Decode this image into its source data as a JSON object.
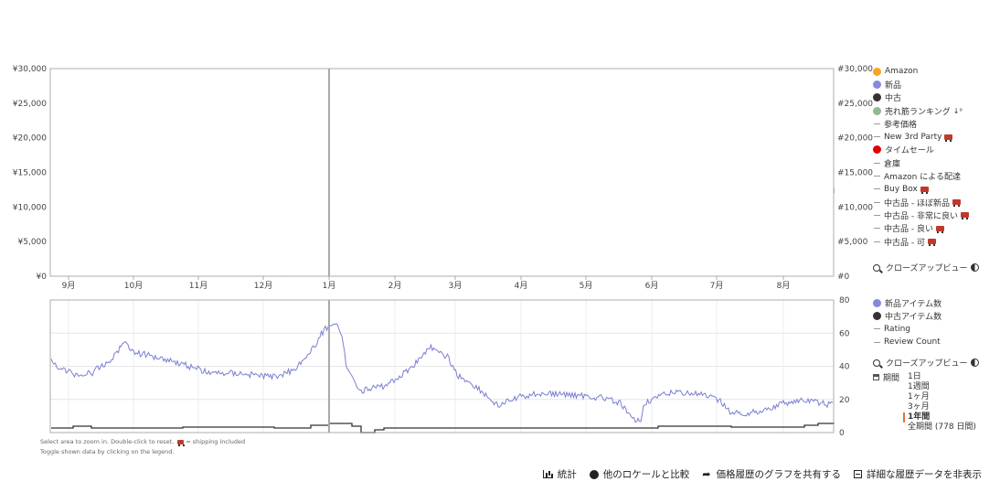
{
  "top_chart": {
    "y_left_ticks": [
      "¥30,000",
      "¥25,000",
      "¥20,000",
      "¥15,000",
      "¥10,000",
      "¥5,000",
      "¥0"
    ],
    "y_right_ticks": [
      "#30,000",
      "#25,000",
      "#20,000",
      "#15,000",
      "#10,000",
      "#5,000",
      "#0"
    ],
    "x_ticks": [
      "9月",
      "10月",
      "11月",
      "12月",
      "1月",
      "2月",
      "3月",
      "4月",
      "5月",
      "6月",
      "7月",
      "8月"
    ]
  },
  "bottom_chart": {
    "y_right_ticks": [
      "80",
      "60",
      "40",
      "20",
      "0"
    ]
  },
  "legend_top": [
    {
      "label": "Amazon",
      "marker": "dot",
      "color": "#f5a623"
    },
    {
      "label": "新品",
      "marker": "dot",
      "color": "#8888dd"
    },
    {
      "label": "中古",
      "marker": "dot",
      "color": "#333333"
    },
    {
      "label": "売れ筋ランキング",
      "marker": "dot",
      "color": "#8dbb8d",
      "extra": "sort-icon"
    },
    {
      "label": "参考価格",
      "marker": "dash",
      "color": "#999999"
    },
    {
      "label": "New 3rd Party",
      "marker": "dash",
      "color": "#999999",
      "truck": true
    },
    {
      "label": "タイムセール",
      "marker": "dot",
      "color": "#e00000"
    },
    {
      "label": "倉庫",
      "marker": "dash",
      "color": "#999999"
    },
    {
      "label": "Amazon による配達",
      "marker": "dash",
      "color": "#999999"
    },
    {
      "label": "Buy Box",
      "marker": "dash",
      "color": "#999999",
      "truck": true
    },
    {
      "label": "中古品 - ほぼ新品",
      "marker": "dash",
      "color": "#999999",
      "truck": true
    },
    {
      "label": "中古品 - 非常に良い",
      "marker": "dash",
      "color": "#999999",
      "truck": true
    },
    {
      "label": "中古品 - 良い",
      "marker": "dash",
      "color": "#999999",
      "truck": true
    },
    {
      "label": "中古品 - 可",
      "marker": "dash",
      "color": "#999999",
      "truck": true
    }
  ],
  "legend_bottom": [
    {
      "label": "新品アイテム数",
      "marker": "dot",
      "color": "#8888dd"
    },
    {
      "label": "中古アイテム数",
      "marker": "dot",
      "color": "#333333"
    },
    {
      "label": "Rating",
      "marker": "dash",
      "color": "#999999"
    },
    {
      "label": "Review Count",
      "marker": "dash",
      "color": "#999999"
    }
  ],
  "closeup_label": "クローズアップビュー",
  "range": {
    "label": "期間",
    "options": [
      "1日",
      "1週間",
      "1ヶ月",
      "3ヶ月",
      "1年間",
      "全期間 (778 日間)"
    ],
    "active_index": 4
  },
  "hint": {
    "line1a": "Select area to zoom in. Double-click to reset.",
    "line1b": "= shipping included",
    "line2": "Toggle shown data by clicking on the legend."
  },
  "footer": {
    "stats": "統計",
    "compare": "他のロケールと比較",
    "share": "価格履歴のグラフを共有する",
    "hide": "詳細な履歴データを非表示"
  },
  "colors": {
    "amazon_fill": "#fde3cc",
    "new": "#7b7fd4",
    "used": "#333333",
    "rank": "#7fb27f",
    "amazon": "#f5a623"
  }
}
